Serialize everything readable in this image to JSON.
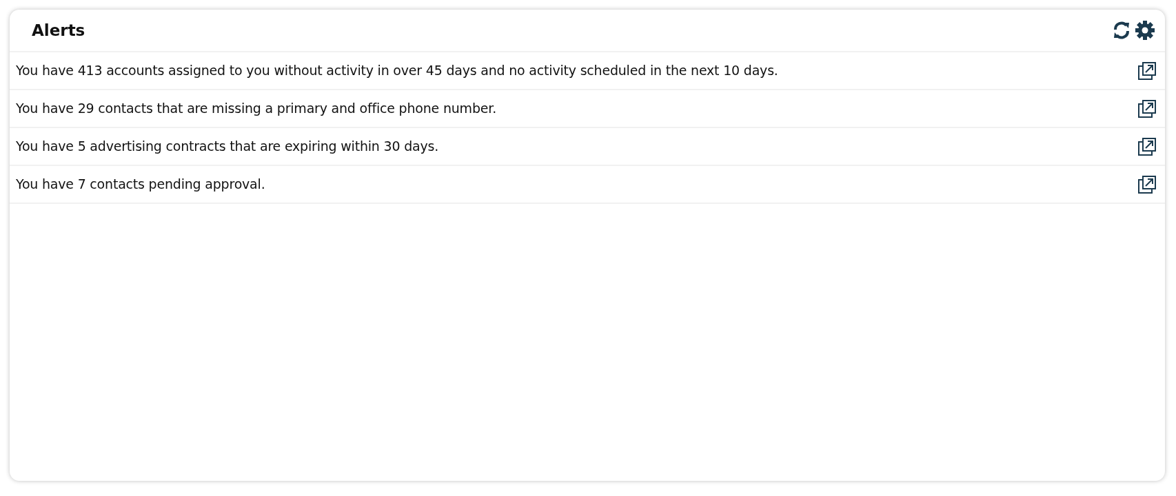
{
  "panel": {
    "title": "Alerts"
  },
  "alerts": [
    {
      "text": "You have 413 accounts assigned to you without activity in over 45 days and no activity scheduled in the next 10 days."
    },
    {
      "text": "You have 29 contacts that are missing a primary and office phone number."
    },
    {
      "text": "You have 5 advertising contracts that are expiring within 30 days."
    },
    {
      "text": "You have 7 contacts pending approval."
    }
  ]
}
